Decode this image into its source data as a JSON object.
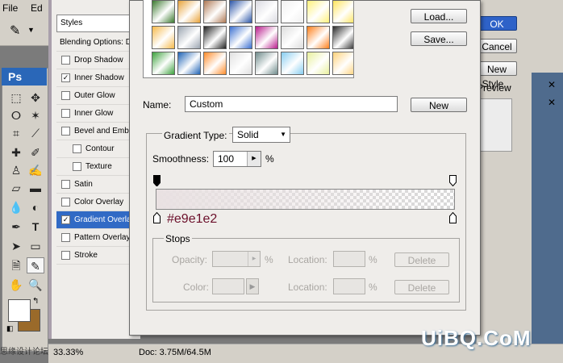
{
  "app": {
    "menu": [
      "File",
      "Ed"
    ],
    "logo": "Ps",
    "status": {
      "zoom": "33.33%",
      "doc": "Doc: 3.75M/64.5M"
    },
    "fg_color": "#ffffff",
    "bg_color": "#9a6a2a"
  },
  "right_panel": {
    "ok": "OK",
    "cancel": "Cancel",
    "new_style": "New Style...",
    "preview": "Preview"
  },
  "layer_style": {
    "header": "Styles",
    "items": [
      {
        "label": "Blending Options: Default",
        "checkbox": false,
        "checked": false,
        "indent": false,
        "selected": false
      },
      {
        "label": "Drop Shadow",
        "checkbox": true,
        "checked": false,
        "indent": false,
        "selected": false
      },
      {
        "label": "Inner Shadow",
        "checkbox": true,
        "checked": true,
        "indent": false,
        "selected": false
      },
      {
        "label": "Outer Glow",
        "checkbox": true,
        "checked": false,
        "indent": false,
        "selected": false
      },
      {
        "label": "Inner Glow",
        "checkbox": true,
        "checked": false,
        "indent": false,
        "selected": false
      },
      {
        "label": "Bevel and Emboss",
        "checkbox": true,
        "checked": false,
        "indent": false,
        "selected": false
      },
      {
        "label": "Contour",
        "checkbox": true,
        "checked": false,
        "indent": true,
        "selected": false
      },
      {
        "label": "Texture",
        "checkbox": true,
        "checked": false,
        "indent": true,
        "selected": false
      },
      {
        "label": "Satin",
        "checkbox": true,
        "checked": false,
        "indent": false,
        "selected": false
      },
      {
        "label": "Color Overlay",
        "checkbox": true,
        "checked": false,
        "indent": false,
        "selected": false
      },
      {
        "label": "Gradient Overlay",
        "checkbox": true,
        "checked": true,
        "indent": false,
        "selected": true
      },
      {
        "label": "Pattern Overlay",
        "checkbox": true,
        "checked": false,
        "indent": false,
        "selected": false
      },
      {
        "label": "Stroke",
        "checkbox": true,
        "checked": false,
        "indent": false,
        "selected": false
      }
    ]
  },
  "gradient_editor": {
    "load": "Load...",
    "save": "Save...",
    "name_label": "Name:",
    "name_value": "Custom",
    "new_button": "New",
    "type_label": "Gradient Type:",
    "type_value": "Solid",
    "smooth_label": "Smoothness:",
    "smooth_value": "100",
    "smooth_unit": "%",
    "color_hex": "#e9e1e2",
    "stops_title": "Stops",
    "opacity_label": "Opacity:",
    "opacity_unit": "%",
    "location_label": "Location:",
    "location_unit": "%",
    "delete_label": "Delete",
    "color_label": "Color:",
    "presets": [
      [
        "#3b7a2f",
        "#e8a33a",
        "#b07a55",
        "#2c56a8",
        "#d9d9e0",
        "#f0f0f0",
        "#fff27a",
        "#ffe45c"
      ],
      [
        "#f6b94a",
        "#9aa4b0",
        "#222222",
        "#3a6fd0",
        "#b81c8c",
        "#dcdcdc",
        "#ff7f1a",
        "#2a2a2a"
      ],
      [
        "#3da23d",
        "#1f63b5",
        "#ff8c2a",
        "#e0e0e0",
        "#6f8b8b",
        "#87cdf0",
        "#e8f09c",
        "#ffd27a"
      ]
    ]
  },
  "watermark": {
    "main": "UiBQ.CoM",
    "left": "思缘设计论坛"
  }
}
